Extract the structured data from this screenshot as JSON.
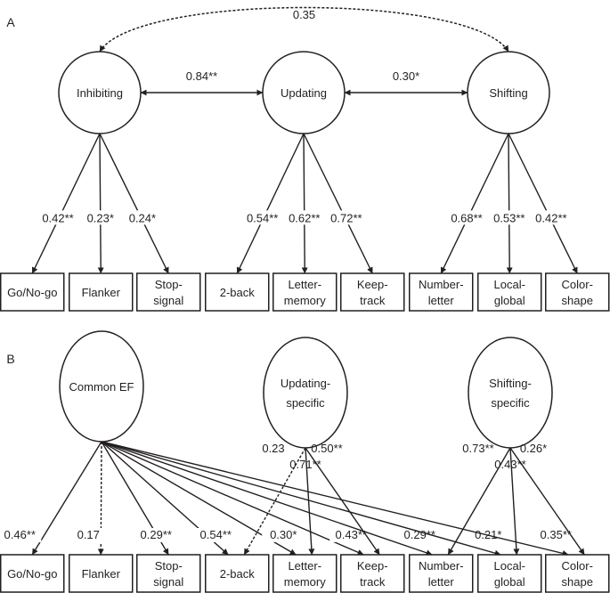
{
  "panels": [
    {
      "id": "A",
      "label": "A",
      "latents": [
        {
          "id": "inh",
          "label": [
            "Inhibiting"
          ]
        },
        {
          "id": "upd",
          "label": [
            "Updating"
          ]
        },
        {
          "id": "shf",
          "label": [
            "Shifting"
          ]
        }
      ],
      "correlations": [
        {
          "from": "inh",
          "to": "upd",
          "value": "0.84**",
          "style": "solid"
        },
        {
          "from": "upd",
          "to": "shf",
          "value": "0.30*",
          "style": "solid"
        },
        {
          "from": "inh",
          "to": "shf",
          "value": "0.35",
          "style": "dashed"
        }
      ],
      "tasks": [
        {
          "label": [
            "Go/No-go"
          ]
        },
        {
          "label": [
            "Flanker"
          ]
        },
        {
          "label": [
            "Stop-",
            "signal"
          ]
        },
        {
          "label": [
            "2-back"
          ]
        },
        {
          "label": [
            "Letter-",
            "memory"
          ]
        },
        {
          "label": [
            "Keep-",
            "track"
          ]
        },
        {
          "label": [
            "Number-",
            "letter"
          ]
        },
        {
          "label": [
            "Local-",
            "global"
          ]
        },
        {
          "label": [
            "Color-",
            "shape"
          ]
        }
      ],
      "loadings": [
        {
          "from": "inh",
          "task": 0,
          "value": "0.42**",
          "style": "solid"
        },
        {
          "from": "inh",
          "task": 1,
          "value": "0.23*",
          "style": "solid"
        },
        {
          "from": "inh",
          "task": 2,
          "value": "0.24*",
          "style": "solid"
        },
        {
          "from": "upd",
          "task": 3,
          "value": "0.54**",
          "style": "solid"
        },
        {
          "from": "upd",
          "task": 4,
          "value": "0.62**",
          "style": "solid"
        },
        {
          "from": "upd",
          "task": 5,
          "value": "0.72**",
          "style": "solid"
        },
        {
          "from": "shf",
          "task": 6,
          "value": "0.68**",
          "style": "solid"
        },
        {
          "from": "shf",
          "task": 7,
          "value": "0.53**",
          "style": "solid"
        },
        {
          "from": "shf",
          "task": 8,
          "value": "0.42**",
          "style": "solid"
        }
      ]
    },
    {
      "id": "B",
      "label": "B",
      "latents": [
        {
          "id": "com",
          "label": [
            "Common EF"
          ]
        },
        {
          "id": "ups",
          "label": [
            "Updating-",
            "specific"
          ]
        },
        {
          "id": "shs",
          "label": [
            "Shifting-",
            "specific"
          ]
        }
      ],
      "correlations": [],
      "tasks": [
        {
          "label": [
            "Go/No-go"
          ]
        },
        {
          "label": [
            "Flanker"
          ]
        },
        {
          "label": [
            "Stop-",
            "signal"
          ]
        },
        {
          "label": [
            "2-back"
          ]
        },
        {
          "label": [
            "Letter-",
            "memory"
          ]
        },
        {
          "label": [
            "Keep-",
            "track"
          ]
        },
        {
          "label": [
            "Number-",
            "letter"
          ]
        },
        {
          "label": [
            "Local-",
            "global"
          ]
        },
        {
          "label": [
            "Color-",
            "shape"
          ]
        }
      ],
      "loadings": [
        {
          "from": "com",
          "task": 0,
          "value": "0.46**",
          "style": "solid"
        },
        {
          "from": "com",
          "task": 1,
          "value": "0.17",
          "style": "dashed"
        },
        {
          "from": "com",
          "task": 2,
          "value": "0.29**",
          "style": "solid"
        },
        {
          "from": "com",
          "task": 3,
          "value": "0.54**",
          "style": "solid"
        },
        {
          "from": "com",
          "task": 4,
          "value": "0.30*",
          "style": "solid"
        },
        {
          "from": "com",
          "task": 5,
          "value": "0.43**",
          "style": "solid"
        },
        {
          "from": "com",
          "task": 6,
          "value": "0.29**",
          "style": "solid"
        },
        {
          "from": "com",
          "task": 7,
          "value": "0.21*",
          "style": "solid"
        },
        {
          "from": "com",
          "task": 8,
          "value": "0.35**",
          "style": "solid"
        },
        {
          "from": "ups",
          "task": 3,
          "value": "0.23",
          "style": "dashed"
        },
        {
          "from": "ups",
          "task": 4,
          "value": "0.71**",
          "style": "solid"
        },
        {
          "from": "ups",
          "task": 5,
          "value": "0.50**",
          "style": "solid"
        },
        {
          "from": "shs",
          "task": 6,
          "value": "0.73**",
          "style": "solid"
        },
        {
          "from": "shs",
          "task": 7,
          "value": "0.43**",
          "style": "solid"
        },
        {
          "from": "shs",
          "task": 8,
          "value": "0.26*",
          "style": "solid"
        }
      ]
    }
  ],
  "colors": {
    "ink": "#231f20",
    "background": "#ffffff"
  }
}
